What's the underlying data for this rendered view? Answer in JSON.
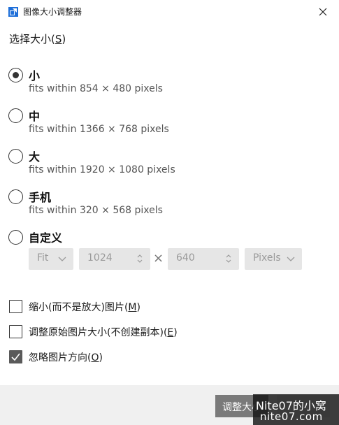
{
  "window": {
    "title": "图像大小调整器",
    "icon": "image-resizer-app-icon",
    "close_icon": "close-icon"
  },
  "size_section": {
    "label": "选择大小",
    "mnemonic": "S"
  },
  "size_options": [
    {
      "title": "小",
      "description": "fits within 854 × 480 pixels",
      "selected": true
    },
    {
      "title": "中",
      "description": "fits within 1366 × 768 pixels",
      "selected": false
    },
    {
      "title": "大",
      "description": "fits within 1920 × 1080 pixels",
      "selected": false
    },
    {
      "title": "手机",
      "description": "fits within 320 × 568 pixels",
      "selected": false
    },
    {
      "title": "自定义",
      "description": "",
      "selected": false
    }
  ],
  "custom": {
    "fit_mode": "Fit",
    "width": "1024",
    "times": "×",
    "height": "640",
    "unit": "Pixels",
    "enabled": false
  },
  "checkboxes": [
    {
      "label": "缩小(而不是放大)图片",
      "mnemonic": "M",
      "checked": false
    },
    {
      "label": "调整原始图片大小(不创建副本)",
      "mnemonic": "E",
      "checked": false
    },
    {
      "label": "忽略图片方向",
      "mnemonic": "O",
      "checked": true
    }
  ],
  "footer": {
    "primary_button": "调整大小"
  },
  "watermark": {
    "line1": "Nite07的小窝",
    "line2": "nite07.com"
  },
  "colors": {
    "accent": "#5a5a5a",
    "disabled_field": "#e6e6e6",
    "footer_bg": "#f0f0f0"
  }
}
